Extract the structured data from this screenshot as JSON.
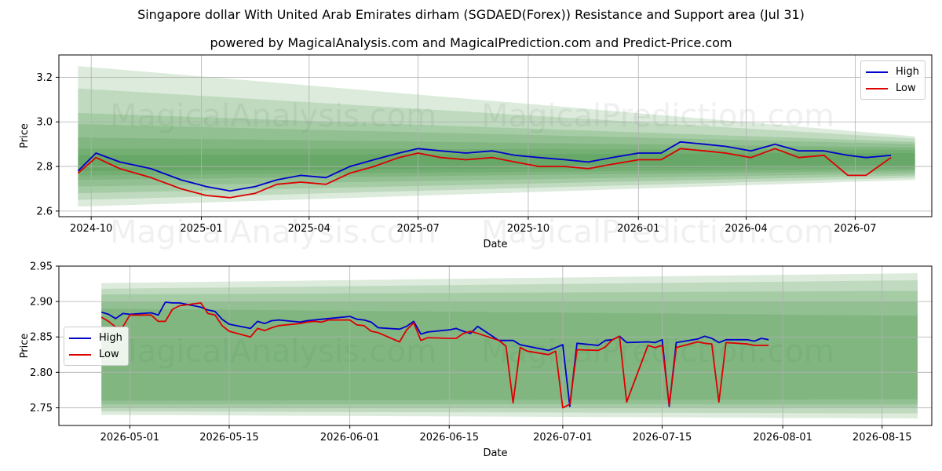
{
  "suptitle": "Singapore dollar With United Arab Emirates dirham (SGDAED(Forex)) Resistance and Support area (Jul 31)",
  "subtitle": "powered by MagicalAnalysis.com and MagicalPrediction.com and Predict-Price.com",
  "watermarks": [
    "MagicalAnalysis.com",
    "MagicalPrediction.com"
  ],
  "colors": {
    "high": "#0000cc",
    "low": "#dd0000",
    "band": "#2e8b2e",
    "grid": "#b0b0b0"
  },
  "chart_data": [
    {
      "type": "line",
      "xlabel": "Date",
      "ylabel": "Price",
      "x_type": "date",
      "xlim": [
        "2024-09-04",
        "2026-09-03"
      ],
      "ylim": [
        2.575,
        3.3
      ],
      "xticks": [
        "2024-10-01",
        "2025-01-01",
        "2025-04-01",
        "2025-07-01",
        "2025-10-01",
        "2026-01-01",
        "2026-04-01",
        "2026-07-01"
      ],
      "xtick_labels": [
        "2024-10",
        "2025-01",
        "2025-04",
        "2025-07",
        "2025-10",
        "2026-01",
        "2026-04",
        "2026-07"
      ],
      "yticks": [
        2.6,
        2.8,
        3.0,
        3.2
      ],
      "ytick_labels": [
        "2.6",
        "2.8",
        "3.0",
        "3.2"
      ],
      "grid": true,
      "legend_position": "top-right",
      "bands": {
        "x_start": "2024-09-20",
        "x_end": "2026-08-20",
        "upper_start": [
          3.25,
          3.15,
          3.04,
          2.99,
          2.93,
          2.88,
          2.85
        ],
        "lower_start": [
          2.62,
          2.65,
          2.68,
          2.71,
          2.74,
          2.76,
          2.78
        ],
        "upper_end": [
          2.935,
          2.925,
          2.91,
          2.9,
          2.885,
          2.875,
          2.86
        ],
        "lower_end": [
          2.74,
          2.75,
          2.76,
          2.77,
          2.78,
          2.79,
          2.8
        ]
      },
      "series": [
        {
          "name": "High",
          "x": [
            "2024-09-20",
            "2024-10-05",
            "2024-10-25",
            "2024-11-20",
            "2024-12-15",
            "2025-01-05",
            "2025-01-25",
            "2025-02-15",
            "2025-03-05",
            "2025-03-25",
            "2025-04-15",
            "2025-05-05",
            "2025-05-25",
            "2025-06-15",
            "2025-07-01",
            "2025-07-20",
            "2025-08-10",
            "2025-09-01",
            "2025-09-20",
            "2025-10-10",
            "2025-11-01",
            "2025-11-20",
            "2025-12-10",
            "2026-01-01",
            "2026-01-20",
            "2026-02-05",
            "2026-02-25",
            "2026-03-15",
            "2026-04-05",
            "2026-04-25",
            "2026-05-15",
            "2026-06-05",
            "2026-06-25",
            "2026-07-10",
            "2026-07-31"
          ],
          "y": [
            2.78,
            2.86,
            2.82,
            2.79,
            2.74,
            2.71,
            2.69,
            2.71,
            2.74,
            2.76,
            2.75,
            2.8,
            2.83,
            2.86,
            2.88,
            2.87,
            2.86,
            2.87,
            2.85,
            2.84,
            2.83,
            2.82,
            2.84,
            2.86,
            2.86,
            2.91,
            2.9,
            2.89,
            2.87,
            2.9,
            2.87,
            2.87,
            2.85,
            2.84,
            2.85
          ]
        },
        {
          "name": "Low",
          "x": [
            "2024-09-20",
            "2024-10-05",
            "2024-10-25",
            "2024-11-20",
            "2024-12-15",
            "2025-01-05",
            "2025-01-25",
            "2025-02-15",
            "2025-03-05",
            "2025-03-25",
            "2025-04-15",
            "2025-05-05",
            "2025-05-25",
            "2025-06-15",
            "2025-07-01",
            "2025-07-20",
            "2025-08-10",
            "2025-09-01",
            "2025-09-20",
            "2025-10-10",
            "2025-11-01",
            "2025-11-20",
            "2025-12-10",
            "2026-01-01",
            "2026-01-20",
            "2026-02-05",
            "2026-02-25",
            "2026-03-15",
            "2026-04-05",
            "2026-04-25",
            "2026-05-15",
            "2026-06-05",
            "2026-06-25",
            "2026-07-10",
            "2026-07-31"
          ],
          "y": [
            2.77,
            2.84,
            2.79,
            2.75,
            2.7,
            2.67,
            2.66,
            2.68,
            2.72,
            2.73,
            2.72,
            2.77,
            2.8,
            2.84,
            2.86,
            2.84,
            2.83,
            2.84,
            2.82,
            2.8,
            2.8,
            2.79,
            2.81,
            2.83,
            2.83,
            2.88,
            2.87,
            2.86,
            2.84,
            2.88,
            2.84,
            2.85,
            2.76,
            2.76,
            2.84
          ]
        }
      ]
    },
    {
      "type": "line",
      "xlabel": "Date",
      "ylabel": "Price",
      "x_type": "date",
      "xlim": [
        "2026-04-21",
        "2026-08-22"
      ],
      "ylim": [
        2.725,
        2.95
      ],
      "xticks": [
        "2026-05-01",
        "2026-05-15",
        "2026-06-01",
        "2026-06-15",
        "2026-07-01",
        "2026-07-15",
        "2026-08-01",
        "2026-08-15"
      ],
      "xtick_labels": [
        "2026-05-01",
        "2026-05-15",
        "2026-06-01",
        "2026-06-15",
        "2026-07-01",
        "2026-07-15",
        "2026-08-01",
        "2026-08-15"
      ],
      "yticks": [
        2.75,
        2.8,
        2.85,
        2.9,
        2.95
      ],
      "ytick_labels": [
        "2.75",
        "2.80",
        "2.85",
        "2.90",
        "2.95"
      ],
      "grid": true,
      "legend_position": "center-left",
      "bands": {
        "x_start": "2026-04-27",
        "x_end": "2026-08-20",
        "upper_start": [
          2.926,
          2.918,
          2.91,
          2.9,
          2.89
        ],
        "lower_start": [
          2.74,
          2.745,
          2.75,
          2.755,
          2.76
        ],
        "upper_end": [
          2.94,
          2.93,
          2.915,
          2.9,
          2.88
        ],
        "lower_end": [
          2.735,
          2.742,
          2.75,
          2.755,
          2.762
        ]
      },
      "series": [
        {
          "name": "High",
          "x": [
            "2026-04-27",
            "2026-04-28",
            "2026-04-29",
            "2026-04-30",
            "2026-05-01",
            "2026-05-04",
            "2026-05-05",
            "2026-05-06",
            "2026-05-07",
            "2026-05-08",
            "2026-05-11",
            "2026-05-12",
            "2026-05-13",
            "2026-05-14",
            "2026-05-15",
            "2026-05-18",
            "2026-05-19",
            "2026-05-20",
            "2026-05-21",
            "2026-05-22",
            "2026-05-25",
            "2026-05-26",
            "2026-05-27",
            "2026-05-28",
            "2026-05-29",
            "2026-06-01",
            "2026-06-02",
            "2026-06-03",
            "2026-06-04",
            "2026-06-05",
            "2026-06-08",
            "2026-06-09",
            "2026-06-10",
            "2026-06-11",
            "2026-06-12",
            "2026-06-15",
            "2026-06-16",
            "2026-06-17",
            "2026-06-18",
            "2026-06-19",
            "2026-06-22",
            "2026-06-23",
            "2026-06-24",
            "2026-06-25",
            "2026-06-26",
            "2026-06-29",
            "2026-06-30",
            "2026-07-01",
            "2026-07-02",
            "2026-07-03",
            "2026-07-06",
            "2026-07-07",
            "2026-07-08",
            "2026-07-09",
            "2026-07-10",
            "2026-07-13",
            "2026-07-14",
            "2026-07-15",
            "2026-07-16",
            "2026-07-17",
            "2026-07-20",
            "2026-07-21",
            "2026-07-22",
            "2026-07-23",
            "2026-07-24",
            "2026-07-27",
            "2026-07-28",
            "2026-07-29",
            "2026-07-30"
          ],
          "y": [
            2.885,
            2.882,
            2.876,
            2.883,
            2.882,
            2.884,
            2.881,
            2.899,
            2.898,
            2.898,
            2.892,
            2.888,
            2.886,
            2.875,
            2.868,
            2.862,
            2.872,
            2.869,
            2.873,
            2.874,
            2.871,
            2.873,
            2.874,
            2.875,
            2.876,
            2.879,
            2.875,
            2.874,
            2.871,
            2.863,
            2.861,
            2.865,
            2.872,
            2.854,
            2.857,
            2.86,
            2.862,
            2.858,
            2.855,
            2.865,
            2.845,
            2.845,
            2.845,
            2.839,
            2.837,
            2.831,
            2.835,
            2.839,
            2.752,
            2.841,
            2.838,
            2.845,
            2.846,
            2.851,
            2.842,
            2.843,
            2.842,
            2.846,
            2.752,
            2.842,
            2.847,
            2.851,
            2.848,
            2.842,
            2.846,
            2.846,
            2.844,
            2.848,
            2.846
          ]
        },
        {
          "name": "Low",
          "x": [
            "2026-04-27",
            "2026-04-28",
            "2026-04-29",
            "2026-04-30",
            "2026-05-01",
            "2026-05-04",
            "2026-05-05",
            "2026-05-06",
            "2026-05-07",
            "2026-05-08",
            "2026-05-11",
            "2026-05-12",
            "2026-05-13",
            "2026-05-14",
            "2026-05-15",
            "2026-05-18",
            "2026-05-19",
            "2026-05-20",
            "2026-05-21",
            "2026-05-22",
            "2026-05-25",
            "2026-05-26",
            "2026-05-27",
            "2026-05-28",
            "2026-05-29",
            "2026-06-01",
            "2026-06-02",
            "2026-06-03",
            "2026-06-04",
            "2026-06-05",
            "2026-06-08",
            "2026-06-09",
            "2026-06-10",
            "2026-06-11",
            "2026-06-12",
            "2026-06-15",
            "2026-06-16",
            "2026-06-17",
            "2026-06-18",
            "2026-06-19",
            "2026-06-22",
            "2026-06-23",
            "2026-06-24",
            "2026-06-25",
            "2026-06-26",
            "2026-06-29",
            "2026-06-30",
            "2026-07-01",
            "2026-07-02",
            "2026-07-03",
            "2026-07-06",
            "2026-07-07",
            "2026-07-08",
            "2026-07-09",
            "2026-07-10",
            "2026-07-13",
            "2026-07-14",
            "2026-07-15",
            "2026-07-16",
            "2026-07-17",
            "2026-07-20",
            "2026-07-21",
            "2026-07-22",
            "2026-07-23",
            "2026-07-24",
            "2026-07-27",
            "2026-07-28",
            "2026-07-29",
            "2026-07-30"
          ],
          "y": [
            2.878,
            2.872,
            2.864,
            2.864,
            2.881,
            2.881,
            2.872,
            2.872,
            2.889,
            2.894,
            2.898,
            2.883,
            2.881,
            2.866,
            2.858,
            2.85,
            2.862,
            2.859,
            2.863,
            2.866,
            2.869,
            2.871,
            2.872,
            2.871,
            2.874,
            2.874,
            2.867,
            2.866,
            2.858,
            2.856,
            2.843,
            2.86,
            2.87,
            2.845,
            2.849,
            2.848,
            2.848,
            2.855,
            2.858,
            2.855,
            2.845,
            2.837,
            2.757,
            2.835,
            2.83,
            2.825,
            2.83,
            2.75,
            2.755,
            2.832,
            2.831,
            2.836,
            2.846,
            2.851,
            2.758,
            2.838,
            2.835,
            2.838,
            2.754,
            2.835,
            2.843,
            2.841,
            2.84,
            2.758,
            2.842,
            2.84,
            2.838,
            2.838,
            2.838
          ]
        }
      ]
    }
  ]
}
